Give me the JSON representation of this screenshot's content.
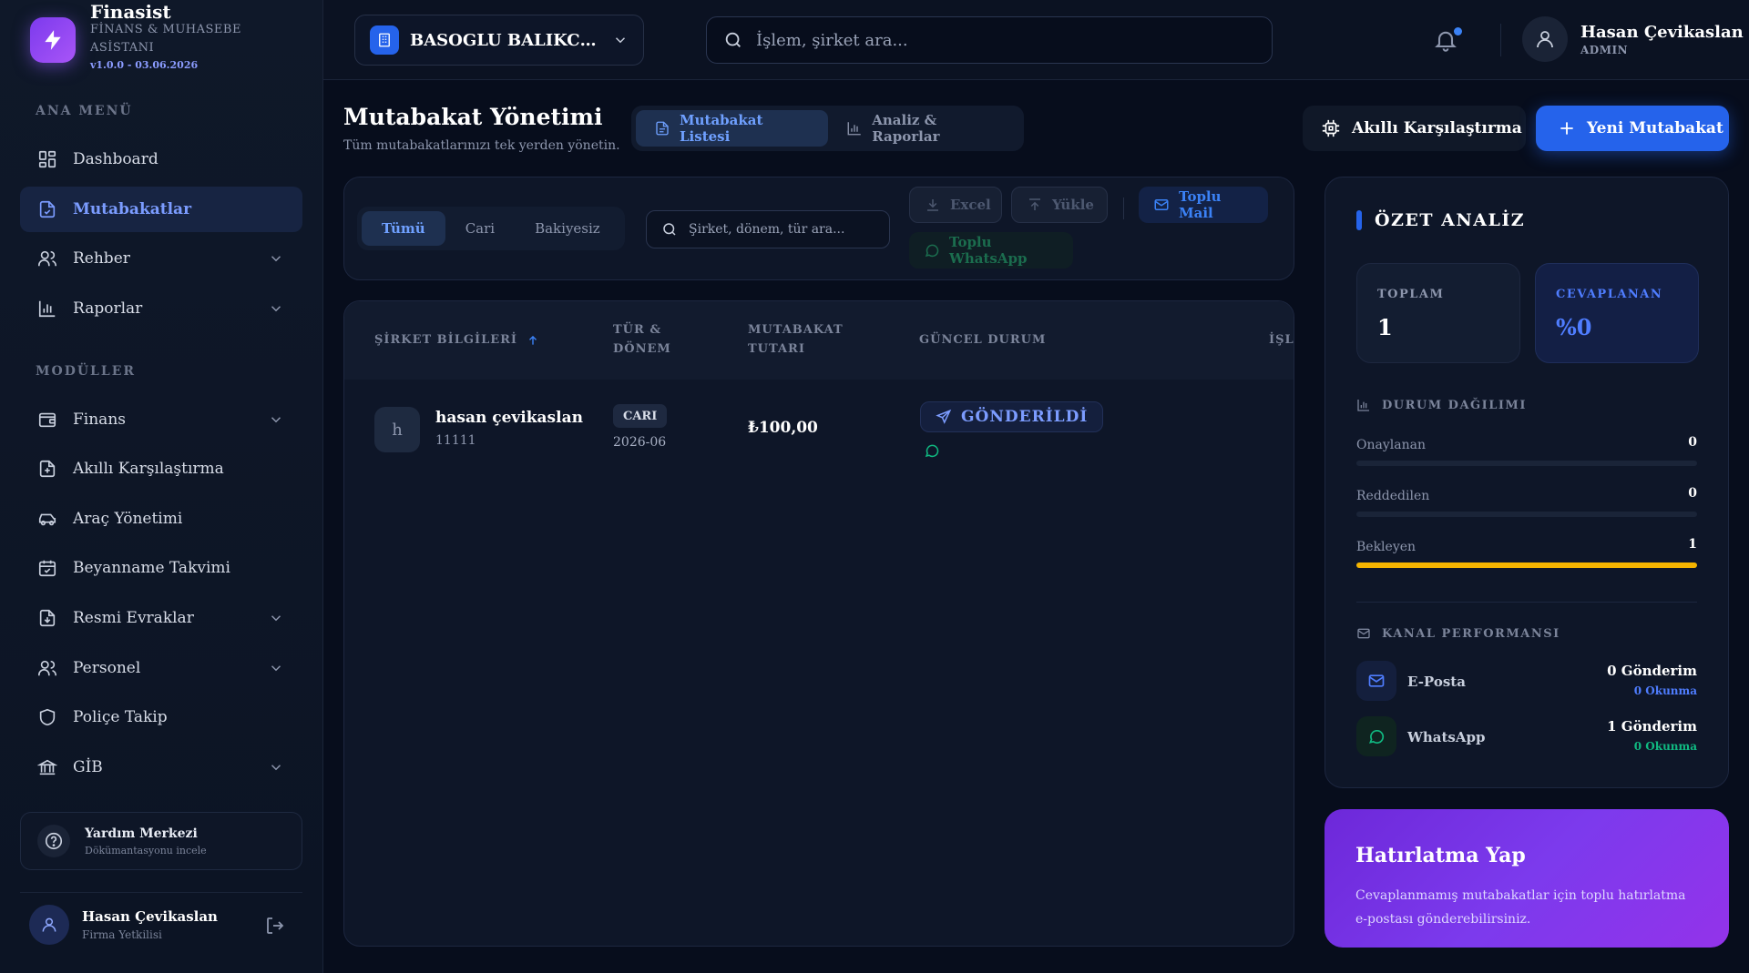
{
  "brand": {
    "name": "Finasist",
    "subtitle": "FİNANS & MUHASEBE ASİSTANI",
    "version": "v1.0.0 - 03.06.2026"
  },
  "sidebar": {
    "main_menu_label": "ANA MENÜ",
    "modules_label": "MODÜLLER",
    "main_items": [
      {
        "label": "Dashboard",
        "icon": "grid-icon"
      },
      {
        "label": "Mutabakatlar",
        "icon": "document-check-icon",
        "active": true
      },
      {
        "label": "Rehber",
        "icon": "users-icon",
        "expandable": true
      },
      {
        "label": "Raporlar",
        "icon": "bar-chart-icon",
        "expandable": true
      }
    ],
    "module_items": [
      {
        "label": "Finans",
        "icon": "wallet-icon",
        "expandable": true
      },
      {
        "label": "Akıllı Karşılaştırma",
        "icon": "file-compare-icon"
      },
      {
        "label": "Araç Yönetimi",
        "icon": "car-icon"
      },
      {
        "label": "Beyanname Takvimi",
        "icon": "calendar-icon"
      },
      {
        "label": "Resmi Evraklar",
        "icon": "file-download-icon",
        "expandable": true
      },
      {
        "label": "Personel",
        "icon": "users-icon",
        "expandable": true
      },
      {
        "label": "Poliçe Takip",
        "icon": "shield-icon"
      },
      {
        "label": "GİB",
        "icon": "bank-icon",
        "expandable": true
      }
    ],
    "help": {
      "title": "Yardım Merkezi",
      "subtitle": "Dökümantasyonu incele"
    },
    "user": {
      "name": "Hasan Çevikaslan",
      "role": "Firma Yetkilisi"
    }
  },
  "topbar": {
    "company": "BASOGLU BALIKCILIK",
    "search_placeholder": "İşlem, şirket ara...",
    "user_name": "Hasan Çevikaslan",
    "user_role": "ADMIN"
  },
  "page": {
    "title": "Mutabakat Yönetimi",
    "subtitle": "Tüm mutabakatlarınızı tek yerden yönetin.",
    "view_tabs": [
      {
        "label": "Mutabakat Listesi",
        "active": true
      },
      {
        "label": "Analiz & Raporlar",
        "active": false
      }
    ],
    "compare_button": "Akıllı Karşılaştırma",
    "new_button": "Yeni Mutabakat"
  },
  "toolbar": {
    "filters": [
      {
        "label": "Tümü",
        "active": true
      },
      {
        "label": "Cari",
        "active": false
      },
      {
        "label": "Bakiyesiz",
        "active": false
      }
    ],
    "search_placeholder": "Şirket, dönem, tür ara...",
    "excel": "Excel",
    "upload": "Yükle",
    "bulk_mail": "Toplu Mail",
    "bulk_whatsapp": "Toplu WhatsApp"
  },
  "table": {
    "columns": {
      "company": "ŞİRKET BİLGİLERİ",
      "type_period_1": "TÜR &",
      "type_period_2": "DÖNEM",
      "amount_1": "MUTABAKAT",
      "amount_2": "TUTARI",
      "status": "GÜNCEL DURUM",
      "actions": "İŞLEMLER"
    },
    "rows": [
      {
        "avatar": "h",
        "company": "hasan çevikaslan",
        "code": "11111",
        "type": "CARI",
        "period": "2026-06",
        "amount": "₺100,00",
        "status": "GÖNDERİLDİ"
      }
    ]
  },
  "summary": {
    "title": "ÖZET ANALİZ",
    "total_label": "TOPLAM",
    "total_value": "1",
    "answered_label": "CEVAPLANAN",
    "answered_value": "%0",
    "distribution_title": "DURUM DAĞILIMI",
    "distribution": [
      {
        "label": "Onaylanan",
        "count": "0",
        "fraction": 0,
        "color": "#1a2438"
      },
      {
        "label": "Reddedilen",
        "count": "0",
        "fraction": 0,
        "color": "#1a2438"
      },
      {
        "label": "Bekleyen",
        "count": "1",
        "fraction": 1,
        "color": "#f5b400"
      }
    ],
    "channel_title": "KANAL PERFORMANSI",
    "channels": [
      {
        "name": "E-Posta",
        "sent": "0 Gönderim",
        "read": "0 Okunma",
        "color": "#4f7dff"
      },
      {
        "name": "WhatsApp",
        "sent": "1 Gönderim",
        "read": "0 Okunma",
        "color": "#10b981"
      }
    ]
  },
  "reminder": {
    "title": "Hatırlatma Yap",
    "text": "Cevaplanmamış mutabakatlar için toplu hatırlatma e-postası gönderebilirsiniz."
  },
  "colors": {
    "accent": "#2563eb",
    "brand_purple": "#7c3aed",
    "pending": "#f5b400",
    "whatsapp": "#10b981"
  }
}
